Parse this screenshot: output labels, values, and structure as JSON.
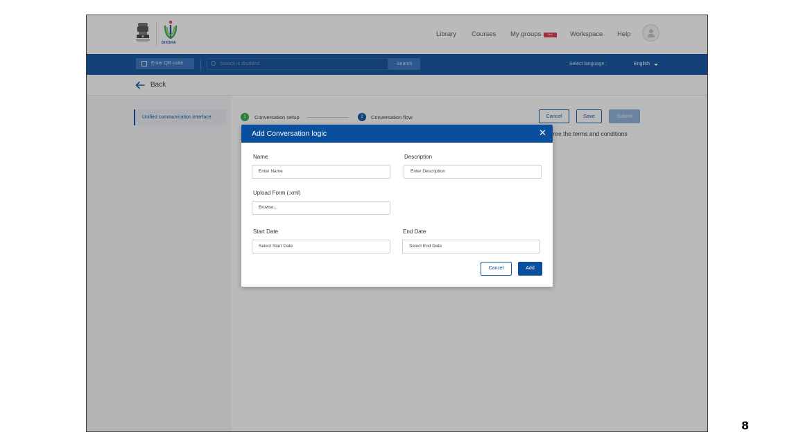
{
  "header": {
    "logo_text": "DIKSHA",
    "nav": {
      "library": "Library",
      "courses": "Courses",
      "my_groups": "My groups",
      "workspace": "Workspace",
      "help": "Help"
    },
    "new_badge": "New"
  },
  "searchbar": {
    "qr_label": "Enter QR code",
    "search_placeholder": "Search is disabled",
    "search_button": "Search",
    "language_label": "Select language :",
    "language_value": "English"
  },
  "back": {
    "label": "Back"
  },
  "sidebar": {
    "item": "Unified communication interface"
  },
  "stepper": {
    "step1_number": "1",
    "step1_label": "Conversation setup",
    "step2_number": "2",
    "step2_label": "Conversation flow"
  },
  "actions": {
    "cancel": "Cancel",
    "save": "Save",
    "submit": "Submit"
  },
  "terms_text": "agree the terms and conditions",
  "modal": {
    "title": "Add Conversation logic",
    "close": "✕",
    "name_label": "Name",
    "name_placeholder": "Enter Name",
    "description_label": "Description",
    "description_placeholder": "Enter Description",
    "upload_label": "Upload Form (.xml)",
    "upload_placeholder": "Browse...",
    "start_label": "Start Date",
    "start_placeholder": "Select Start Date",
    "end_label": "End Date",
    "end_placeholder": "Select End Date",
    "cancel": "Cancel",
    "add": "Add"
  },
  "page_number": "8",
  "colors": {
    "primary": "#0a4f9e",
    "success": "#2ea84a",
    "badge": "#d9344a"
  }
}
